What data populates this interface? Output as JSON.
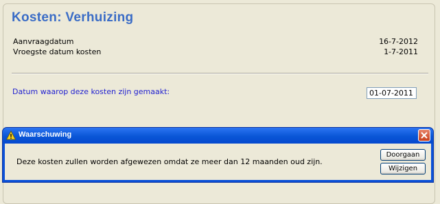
{
  "page": {
    "title": "Kosten: Verhuizing",
    "fields": [
      {
        "label": "Aanvraagdatum",
        "value": "16-7-2012"
      },
      {
        "label": "Vroegste datum kosten",
        "value": "1-7-2011"
      }
    ],
    "date_question": "Datum waarop deze kosten zijn gemaakt:",
    "date_value": "01-07-2011"
  },
  "dialog": {
    "title": "Waarschuwing",
    "message": "Deze kosten zullen worden afgewezen omdat ze meer dan 12 maanden oud zijn.",
    "buttons": {
      "continue": "Doorgaan",
      "edit": "Wijzigen"
    },
    "icon": "warning-icon",
    "close_icon": "close-icon"
  },
  "colors": {
    "title_blue": "#3a6cc6",
    "label_blue": "#2020d0",
    "dialog_titlebar": "#0a56d6",
    "close_red": "#c8401c",
    "background": "#ece9d8"
  }
}
